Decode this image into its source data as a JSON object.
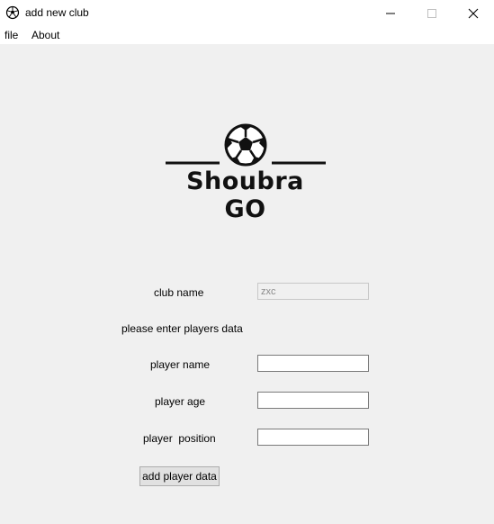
{
  "window": {
    "title": "add new club",
    "icon": "soccer-ball-icon",
    "controls": [
      "minimize-icon",
      "maximize-icon",
      "close-icon"
    ]
  },
  "menu": {
    "items": [
      {
        "label": "file"
      },
      {
        "label": "About"
      }
    ]
  },
  "logo": {
    "text": "Shoubra GO",
    "icon": "soccer-ball-icon"
  },
  "form": {
    "club_name_label": "club name",
    "club_name_value": "zxc",
    "players_prompt": "please enter players data",
    "player_name_label": "player name",
    "player_name_value": "",
    "player_age_label": "player age",
    "player_age_value": "",
    "player_position_label": "player  position",
    "player_position_value": "",
    "add_button_label": "add player data"
  },
  "colors": {
    "background": "#f0f0f0",
    "titlebar": "#ffffff",
    "disabled_field": "#f0f0f0"
  }
}
